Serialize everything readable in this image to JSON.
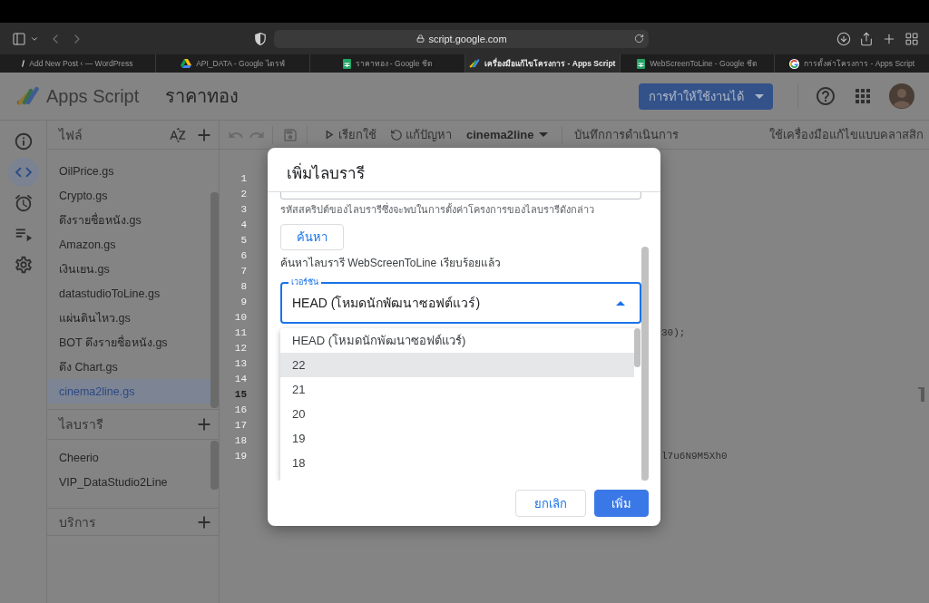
{
  "browser": {
    "url": "script.google.com",
    "tabs": [
      {
        "title": "Add New Post ‹ — WordPress",
        "kind": "wordpress",
        "selected": false
      },
      {
        "title": "API_DATA - Google ไดรฟ์",
        "kind": "drive",
        "selected": false
      },
      {
        "title": "ราคาทอง - Google ชีต",
        "kind": "sheets",
        "selected": false
      },
      {
        "title": "เครื่องมือแก้ไขโครงการ - Apps Script",
        "kind": "apps-script",
        "selected": true
      },
      {
        "title": "WebScreenToLine - Google ชีต",
        "kind": "sheets",
        "selected": false
      },
      {
        "title": "การตั้งค่าโครงการ - Apps Script",
        "kind": "google",
        "selected": false
      }
    ]
  },
  "header": {
    "product": "Apps Script",
    "project": "ราคาทอง",
    "deploy_button": "การทำให้ใช้งานได้"
  },
  "rail": [
    {
      "kind": "info",
      "selected": false
    },
    {
      "kind": "code",
      "selected": true
    },
    {
      "kind": "triggers",
      "selected": false
    },
    {
      "kind": "executions",
      "selected": false
    },
    {
      "kind": "settings",
      "selected": false
    }
  ],
  "files_panel": {
    "title": "ไฟล์",
    "files": [
      {
        "name": "OilPrice.gs",
        "selected": false
      },
      {
        "name": "Crypto.gs",
        "selected": false
      },
      {
        "name": "ดึงรายชื่อหนัง.gs",
        "selected": false
      },
      {
        "name": "Amazon.gs",
        "selected": false
      },
      {
        "name": "เงินเยน.gs",
        "selected": false
      },
      {
        "name": "datastudioToLine.gs",
        "selected": false
      },
      {
        "name": "แผ่นดินไหว.gs",
        "selected": false
      },
      {
        "name": "BOT ดึงรายชื่อหนัง.gs",
        "selected": false
      },
      {
        "name": "ดึง Chart.gs",
        "selected": false
      },
      {
        "name": "cinema2line.gs",
        "selected": true
      }
    ],
    "libraries_title": "ไลบรารี",
    "libraries": [
      "Cheerio",
      "VIP_DataStudio2Line"
    ],
    "services_title": "บริการ"
  },
  "toolbar": {
    "run": "เรียกใช้",
    "debug": "แก้ปัญหา",
    "function": "cinema2line",
    "execution_log": "บันทึกการดำเนินการ",
    "classic_editor": "ใช้เครื่องมือแก้ไขแบบคลาสสิก"
  },
  "editor": {
    "lines": [
      {
        "number": "1",
        "current": false
      },
      {
        "number": "2",
        "current": false
      },
      {
        "number": "3",
        "current": false
      },
      {
        "number": "4",
        "current": false
      },
      {
        "number": "5",
        "current": false
      },
      {
        "number": "6",
        "current": false
      },
      {
        "number": "7",
        "current": false
      },
      {
        "number": "8",
        "current": false
      },
      {
        "number": "9",
        "current": false
      },
      {
        "number": "10",
        "current": false
      },
      {
        "number": "11",
        "code": "30);",
        "current": false
      },
      {
        "number": "12",
        "current": false
      },
      {
        "number": "13",
        "current": false
      },
      {
        "number": "14",
        "current": false
      },
      {
        "number": "15",
        "current": true
      },
      {
        "number": "16",
        "current": false
      },
      {
        "number": "17",
        "current": false
      },
      {
        "number": "18",
        "current": false
      },
      {
        "number": "19",
        "code": "l7u6N9M5Xh0",
        "current": false
      }
    ]
  },
  "dialog": {
    "title": "เพิ่มไลบรารี",
    "hint": "รหัสสคริปต์ของไลบรารีซึ่งจะพบในการตั้งค่าโครงการของไลบรารีดังกล่าว",
    "lookup_button": "ค้นหา",
    "status": "ค้นหาไลบรารี WebScreenToLine เรียบร้อยแล้ว",
    "version": {
      "label": "เวอร์ชัน",
      "value": "HEAD (โหมดนักพัฒนาซอฟต์แวร์)",
      "expanded": true,
      "options": [
        {
          "label": "HEAD (โหมดนักพัฒนาซอฟต์แวร์)",
          "highlighted": false
        },
        {
          "label": "22",
          "highlighted": true
        },
        {
          "label": "21",
          "highlighted": false
        },
        {
          "label": "20",
          "highlighted": false
        },
        {
          "label": "19",
          "highlighted": false
        },
        {
          "label": "18",
          "highlighted": false
        }
      ]
    },
    "buttons": [
      {
        "label": "ยกเลิก",
        "kind": "secondary"
      },
      {
        "label": "เพิ่ม",
        "kind": "primary"
      }
    ]
  }
}
